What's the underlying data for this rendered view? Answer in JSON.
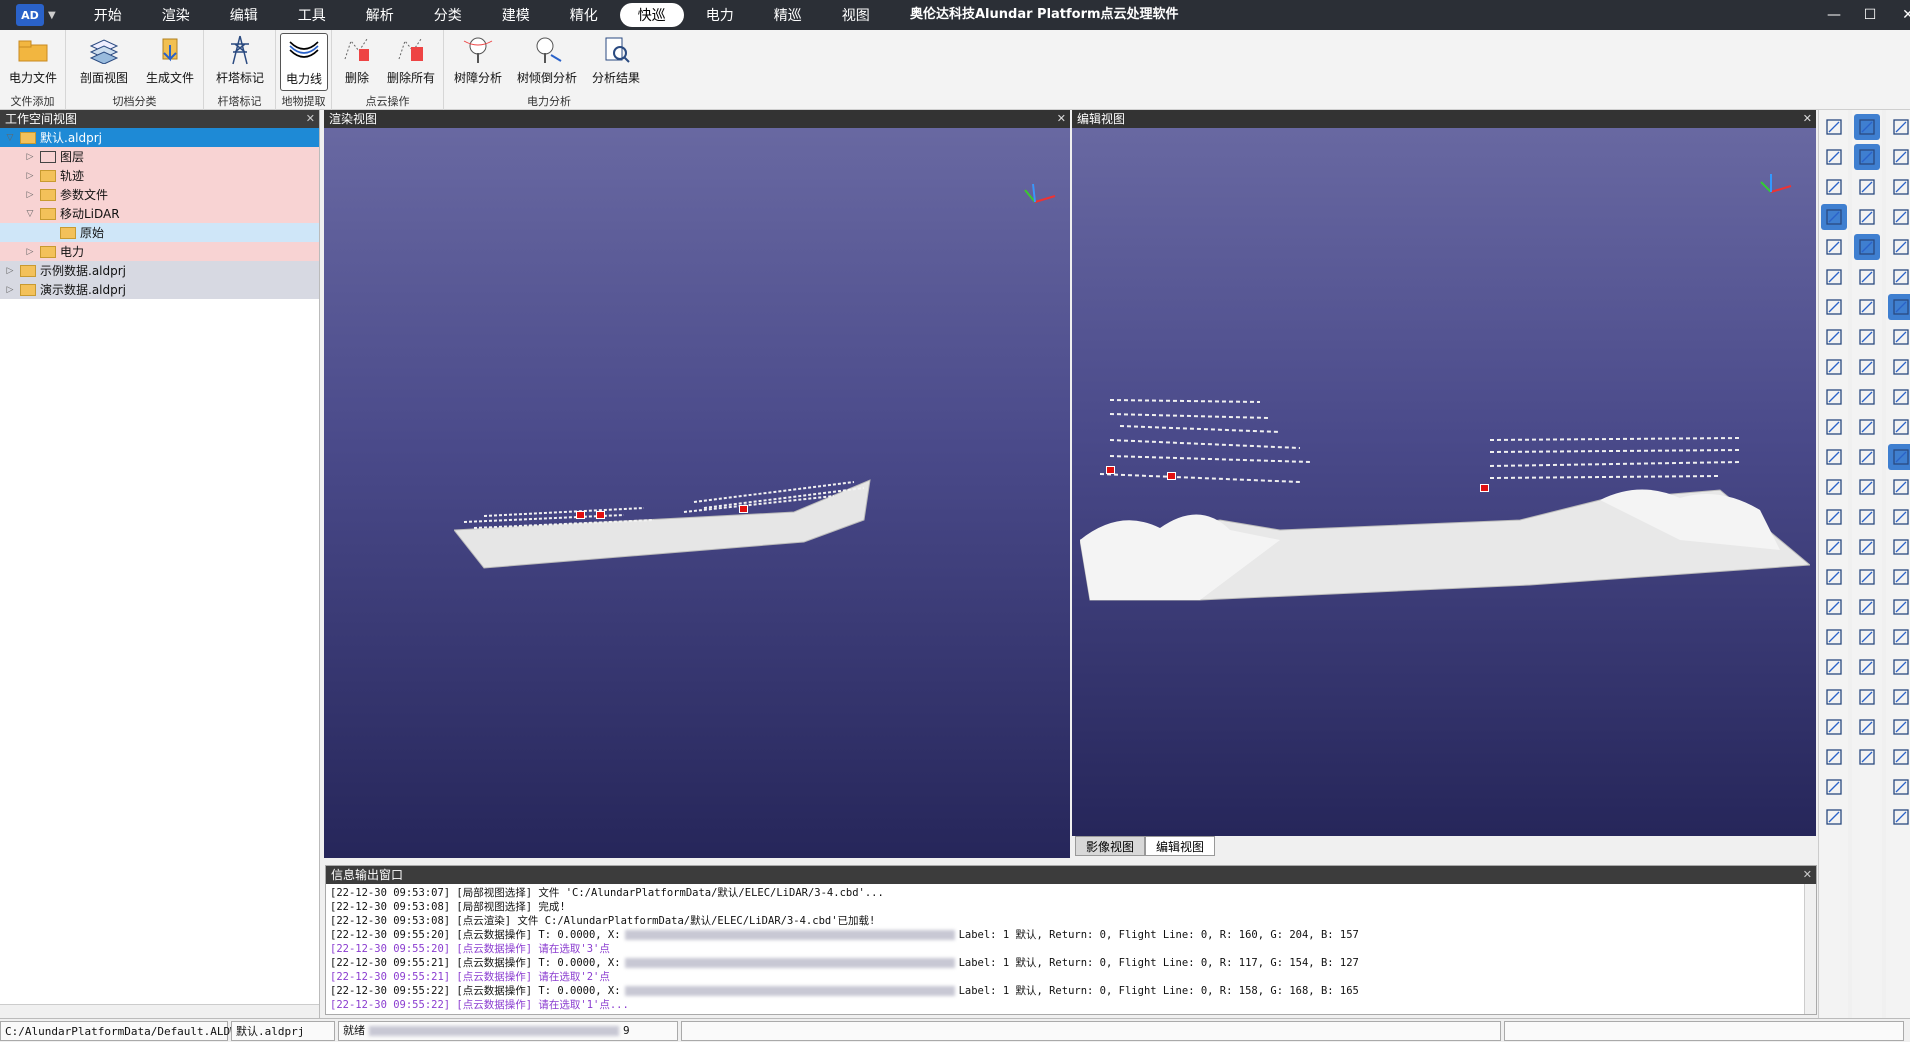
{
  "app": {
    "logo_text": "AD",
    "title": "奥伦达科技Alundar Platform点云处理软件",
    "menu": [
      "开始",
      "渲染",
      "编辑",
      "工具",
      "解析",
      "分类",
      "建模",
      "精化",
      "快巡",
      "电力",
      "精巡",
      "视图"
    ],
    "active_menu_index": 8,
    "window_controls": {
      "minimize": "—",
      "maximize": "☐",
      "close": "✕"
    }
  },
  "ribbon": {
    "groups": [
      {
        "label": "文件添加",
        "buttons": [
          {
            "label": "电力文件",
            "icon": "folder-open-icon"
          }
        ]
      },
      {
        "label": "切档分类",
        "buttons": [
          {
            "label": "剖面视图",
            "icon": "profile-layers-icon"
          },
          {
            "label": "生成文件",
            "icon": "generate-file-icon"
          }
        ]
      },
      {
        "label": "杆塔标记",
        "buttons": [
          {
            "label": "杆塔标记",
            "icon": "tower-icon"
          }
        ]
      },
      {
        "label": "地物提取",
        "buttons": [
          {
            "label": "电力线",
            "icon": "power-line-icon"
          }
        ]
      },
      {
        "label": "点云操作",
        "buttons": [
          {
            "label": "删除",
            "icon": "delete-points-icon"
          },
          {
            "label": "删除所有",
            "icon": "delete-all-icon"
          }
        ]
      },
      {
        "label": "电力分析",
        "buttons": [
          {
            "label": "树障分析",
            "icon": "tree-obstacle-icon"
          },
          {
            "label": "树倾倒分析",
            "icon": "tree-fall-icon"
          },
          {
            "label": "分析结果",
            "icon": "analysis-result-icon"
          }
        ]
      }
    ]
  },
  "workspace": {
    "title": "工作空间视图",
    "close": "✕",
    "nodes": [
      {
        "label": "默认.aldprj",
        "depth": 0,
        "twisty": "▽",
        "style": "blue"
      },
      {
        "label": "图层",
        "depth": 1,
        "twisty": "▷",
        "style": "pink",
        "icon": "layers-icon"
      },
      {
        "label": "轨迹",
        "depth": 1,
        "twisty": "▷",
        "style": "pink"
      },
      {
        "label": "参数文件",
        "depth": 1,
        "twisty": "▷",
        "style": "pink"
      },
      {
        "label": "移动LiDAR",
        "depth": 1,
        "twisty": "▽",
        "style": "pink"
      },
      {
        "label": "原始",
        "depth": 2,
        "twisty": "",
        "style": "lblue"
      },
      {
        "label": "电力",
        "depth": 1,
        "twisty": "▷",
        "style": "pink"
      },
      {
        "label": "示例数据.aldprj",
        "depth": 0,
        "twisty": "▷",
        "style": "gray"
      },
      {
        "label": "演示数据.aldprj",
        "depth": 0,
        "twisty": "▷",
        "style": "gray"
      }
    ]
  },
  "render_view": {
    "title": "渲染视图",
    "close": "✕"
  },
  "edit_view": {
    "title": "编辑视图",
    "close": "✕"
  },
  "view_tabs": [
    "影像视图",
    "编辑视图"
  ],
  "active_view_tab": 1,
  "log": {
    "title": "信息输出窗口",
    "close": "✕",
    "lines": [
      {
        "text": "[22-12-30 09:53:07] [局部视图选择] 文件 'C:/AlundarPlatformData/默认/ELEC/LiDAR/3-4.cbd'...",
        "purple": false,
        "blur": false
      },
      {
        "text": "[22-12-30 09:53:08] [局部视图选择] 完成!",
        "purple": false,
        "blur": false
      },
      {
        "text": "[22-12-30 09:53:08] [点云渲染] 文件 C:/AlundarPlatformData/默认/ELEC/LiDAR/3-4.cbd'已加载!",
        "purple": false,
        "blur": false
      },
      {
        "text": "[22-12-30 09:55:20] [点云数据操作] T: 0.0000, X:",
        "tail": "Label: 1 默认, Return: 0, Flight Line: 0, R: 160, G: 204, B: 157",
        "purple": false,
        "blur": true
      },
      {
        "text": "[22-12-30 09:55:20] [点云数据操作] 请在选取'3'点",
        "purple": true,
        "blur": false
      },
      {
        "text": "[22-12-30 09:55:21] [点云数据操作] T: 0.0000, X:",
        "tail": "Label: 1 默认, Return: 0, Flight Line: 0, R: 117, G: 154, B: 127",
        "purple": false,
        "blur": true
      },
      {
        "text": "[22-12-30 09:55:21] [点云数据操作] 请在选取'2'点",
        "purple": true,
        "blur": false
      },
      {
        "text": "[22-12-30 09:55:22] [点云数据操作] T: 0.0000, X:",
        "tail": "Label: 1 默认, Return: 0, Flight Line: 0, R: 158, G: 168, B: 165",
        "purple": false,
        "blur": true
      },
      {
        "text": "[22-12-30 09:55:22] [点云数据操作] 请在选取'1'点...",
        "purple": true,
        "blur": false
      }
    ]
  },
  "status": {
    "workspace_path": "C:/AlundarPlatformData/Default.ALDWS",
    "project": "默认.aldprj",
    "state": "就绪",
    "coord_tail": "9"
  },
  "colors": {
    "titlebar": "#2b2f36",
    "accent": "#1e8ad6",
    "marker": "#e01010",
    "log_purple": "#8b3dd0"
  }
}
